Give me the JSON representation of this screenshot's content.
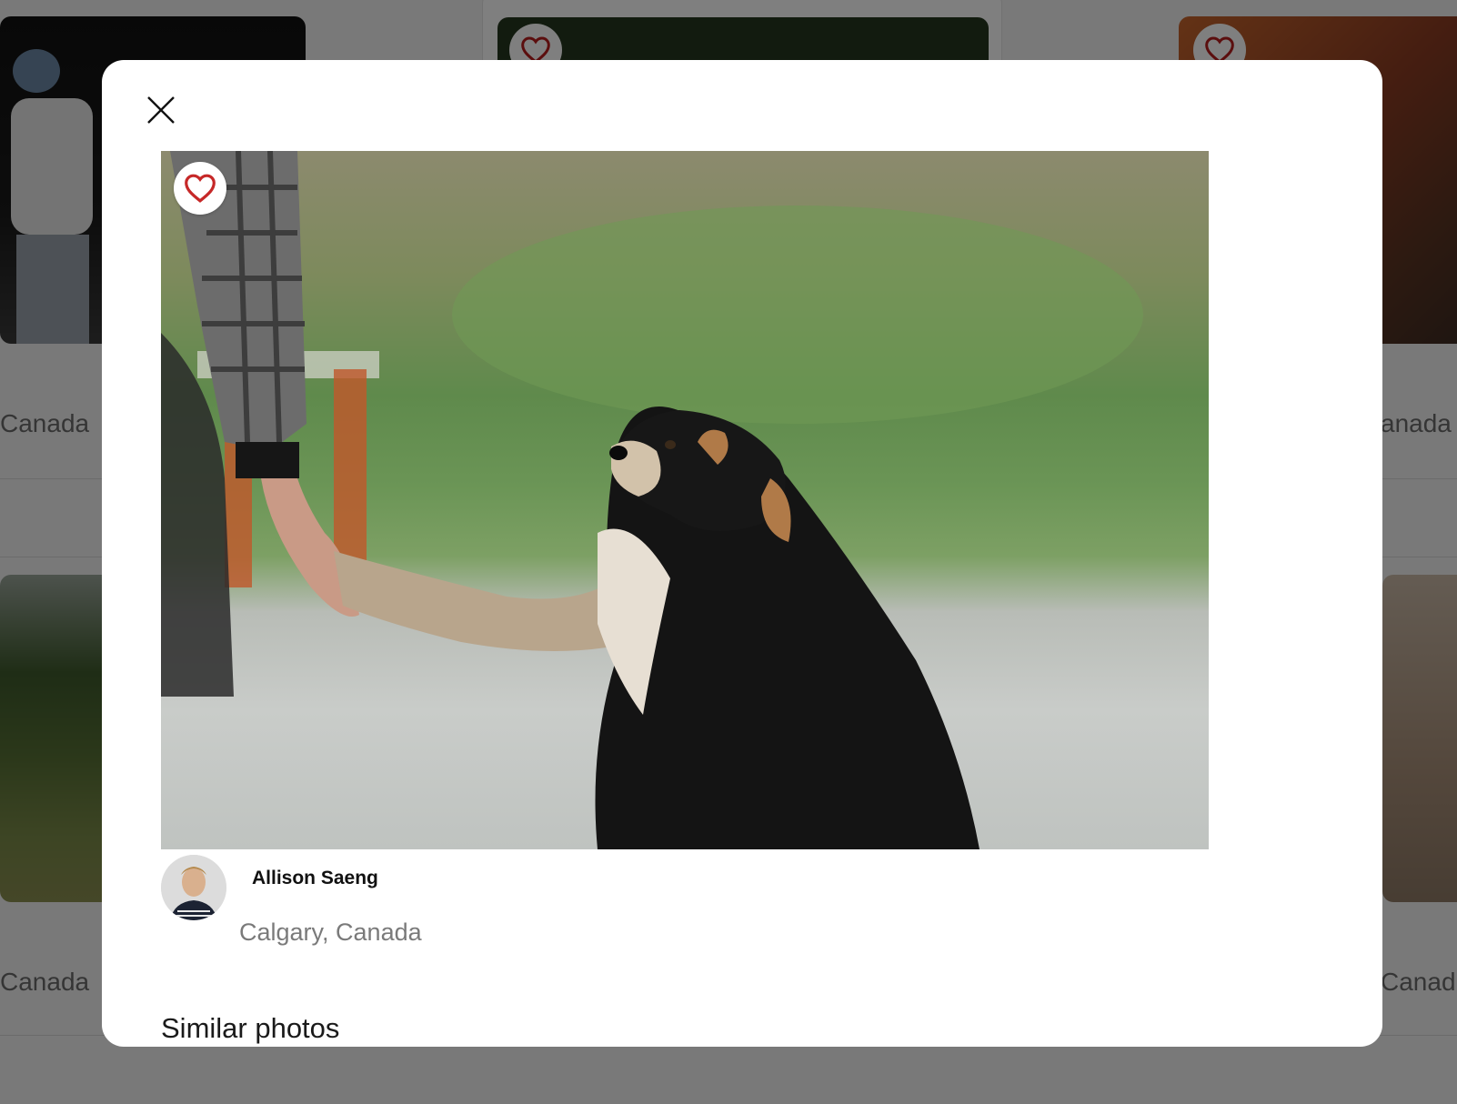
{
  "background": {
    "card_locations": [
      "Canada",
      "anada",
      "Canada",
      "Canad"
    ]
  },
  "modal": {
    "close_icon": "close-icon",
    "favorite_icon": "heart-icon",
    "accent_color": "#c62828",
    "photo": {
      "description_icon": "dog-paw-photo"
    },
    "author": {
      "name": "Allison Saeng",
      "location": "Calgary, Canada"
    },
    "similar_title": "Similar photos"
  }
}
